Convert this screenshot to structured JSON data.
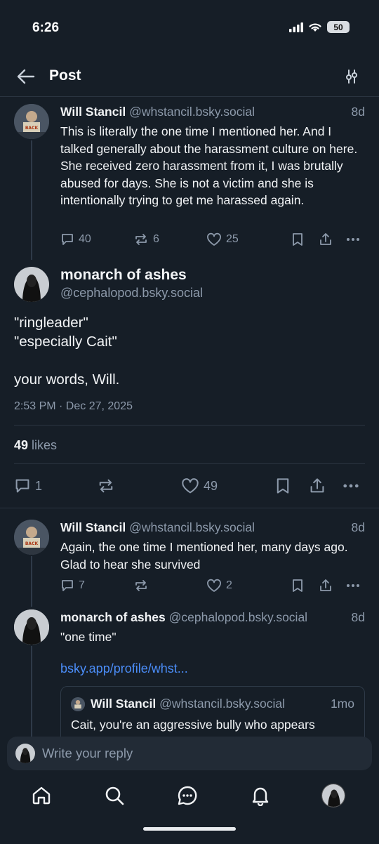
{
  "status_bar": {
    "time": "6:26",
    "battery": "50"
  },
  "header": {
    "title": "Post"
  },
  "posts": [
    {
      "name": "Will Stancil",
      "handle": "@whstancil.bsky.social",
      "age": "8d",
      "text": "This is literally the one time I mentioned her. And I talked generally about the harassment culture on here. She received zero harassment from it, I was brutally abused for days. She is not a victim and she is intentionally trying to get me harassed again.",
      "replies": "40",
      "reposts": "6",
      "likes": "25"
    }
  ],
  "main_post": {
    "name": "monarch of ashes",
    "handle": "@cephalopod.bsky.social",
    "lines": [
      "\"ringleader\"",
      "\"especially Cait\"",
      "your words, Will."
    ],
    "timestamp": "2:53 PM · Dec 27, 2025",
    "likes_count": "49",
    "likes_label": "likes",
    "replies": "1",
    "likes": "49"
  },
  "replies": [
    {
      "name": "Will Stancil",
      "handle": "@whstancil.bsky.social",
      "age": "8d",
      "text": "Again, the one time I mentioned her, many days ago. Glad to hear she survived",
      "replies": "7",
      "likes": "2"
    },
    {
      "name": "monarch of ashes",
      "handle": "@cephalopod.bsky.social",
      "age": "8d",
      "text": "\"one time\"",
      "link": "bsky.app/profile/whst...",
      "quote": {
        "name": "Will Stancil",
        "handle": "@whstancil.bsky.social",
        "age": "1mo",
        "text": "Cait, you're an aggressive bully who appears"
      }
    }
  ],
  "composer": {
    "placeholder": "Write your reply"
  },
  "colors": {
    "background": "#161e27",
    "accent": "#4b8df8",
    "muted": "#8d9aab"
  },
  "icons": [
    "back-arrow-icon",
    "filter-icon",
    "reply-icon",
    "repost-icon",
    "heart-icon",
    "bookmark-icon",
    "share-icon",
    "more-icon",
    "home-icon",
    "search-icon",
    "chat-icon",
    "bell-icon"
  ]
}
